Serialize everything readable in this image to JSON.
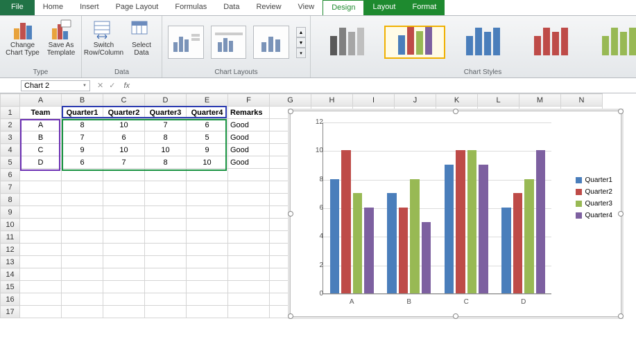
{
  "tabs": {
    "file": "File",
    "list": [
      "Home",
      "Insert",
      "Page Layout",
      "Formulas",
      "Data",
      "Review",
      "View"
    ],
    "context": [
      "Design",
      "Layout",
      "Format"
    ],
    "active_context": "Design"
  },
  "ribbon": {
    "type_group": "Type",
    "data_group": "Data",
    "layouts_group": "Chart Layouts",
    "styles_group": "Chart Styles",
    "change_chart": "Change\nChart Type",
    "save_template": "Save As\nTemplate",
    "switch_rc": "Switch\nRow/Column",
    "select_data": "Select\nData"
  },
  "namebox": "Chart 2",
  "formula": "",
  "columns": [
    "A",
    "B",
    "C",
    "D",
    "E",
    "F",
    "G",
    "H",
    "I",
    "J",
    "K",
    "L",
    "M",
    "N"
  ],
  "rows": 17,
  "table": {
    "headers": [
      "Team",
      "Quarter1",
      "Quarter2",
      "Quarter3",
      "Quarter4",
      "Remarks"
    ],
    "data": [
      [
        "A",
        "8",
        "10",
        "7",
        "6",
        "Good"
      ],
      [
        "B",
        "7",
        "6",
        "8",
        "5",
        "Good"
      ],
      [
        "C",
        "9",
        "10",
        "10",
        "9",
        "Good"
      ],
      [
        "D",
        "6",
        "7",
        "8",
        "10",
        "Good"
      ]
    ]
  },
  "chart_data": {
    "type": "bar",
    "categories": [
      "A",
      "B",
      "C",
      "D"
    ],
    "series": [
      {
        "name": "Quarter1",
        "values": [
          8,
          7,
          9,
          6
        ],
        "color": "#4a7ebb"
      },
      {
        "name": "Quarter2",
        "values": [
          10,
          6,
          10,
          7
        ],
        "color": "#be4b48"
      },
      {
        "name": "Quarter3",
        "values": [
          7,
          8,
          10,
          8
        ],
        "color": "#98b954"
      },
      {
        "name": "Quarter4",
        "values": [
          6,
          5,
          9,
          10
        ],
        "color": "#7d60a0"
      }
    ],
    "ylim": [
      0,
      12
    ],
    "yticks": [
      0,
      2,
      4,
      6,
      8,
      10,
      12
    ],
    "title": "",
    "xlabel": "",
    "ylabel": ""
  },
  "style_palettes": [
    [
      "#595959",
      "#808080",
      "#a6a6a6",
      "#bfbfbf"
    ],
    [
      "#4a7ebb",
      "#be4b48",
      "#98b954",
      "#7d60a0"
    ],
    [
      "#4a7ebb",
      "#4a7ebb",
      "#4a7ebb",
      "#4a7ebb"
    ],
    [
      "#be4b48",
      "#be4b48",
      "#be4b48",
      "#be4b48"
    ],
    [
      "#98b954",
      "#98b954",
      "#98b954",
      "#98b954"
    ]
  ]
}
